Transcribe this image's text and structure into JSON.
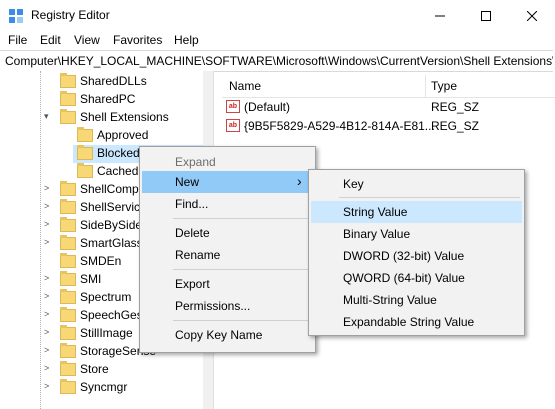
{
  "window": {
    "title": "Registry Editor"
  },
  "menubar": [
    "File",
    "Edit",
    "View",
    "Favorites",
    "Help"
  ],
  "address": "Computer\\HKEY_LOCAL_MACHINE\\SOFTWARE\\Microsoft\\Windows\\CurrentVersion\\Shell Extensions\\B",
  "tree": [
    {
      "label": "SharedDLLs",
      "expander": ""
    },
    {
      "label": "SharedPC",
      "expander": ""
    },
    {
      "label": "Shell Extensions",
      "expander": "▾"
    },
    {
      "label": "Approved",
      "expander": ""
    },
    {
      "label": "Blocked",
      "expander": ""
    },
    {
      "label": "Cached",
      "expander": ""
    },
    {
      "label": "ShellComp",
      "expander": ">"
    },
    {
      "label": "ShellService",
      "expander": ">"
    },
    {
      "label": "SideBySide",
      "expander": ">"
    },
    {
      "label": "SmartGlass",
      "expander": ">"
    },
    {
      "label": "SMDEn",
      "expander": ""
    },
    {
      "label": "SMI",
      "expander": ">"
    },
    {
      "label": "Spectrum",
      "expander": ">"
    },
    {
      "label": "SpeechGest",
      "expander": ">"
    },
    {
      "label": "StillImage",
      "expander": ">"
    },
    {
      "label": "StorageSense",
      "expander": ">"
    },
    {
      "label": "Store",
      "expander": ">"
    },
    {
      "label": "Syncmgr",
      "expander": ">"
    }
  ],
  "list": {
    "headers": {
      "name": "Name",
      "type": "Type"
    },
    "rows": [
      {
        "icon": "ab",
        "name": "(Default)",
        "type": "REG_SZ"
      },
      {
        "icon": "ab",
        "name": "{9B5F5829-A529-4B12-814A-E81...",
        "type": "REG_SZ"
      }
    ]
  },
  "context_menu": {
    "items": [
      "Expand",
      "New",
      "Find...",
      "Delete",
      "Rename",
      "Export",
      "Permissions...",
      "Copy Key Name"
    ],
    "submenu_arrow": "›"
  },
  "new_submenu": {
    "items": [
      "Key",
      "String Value",
      "Binary Value",
      "DWORD (32-bit) Value",
      "QWORD (64-bit) Value",
      "Multi-String Value",
      "Expandable String Value"
    ]
  }
}
